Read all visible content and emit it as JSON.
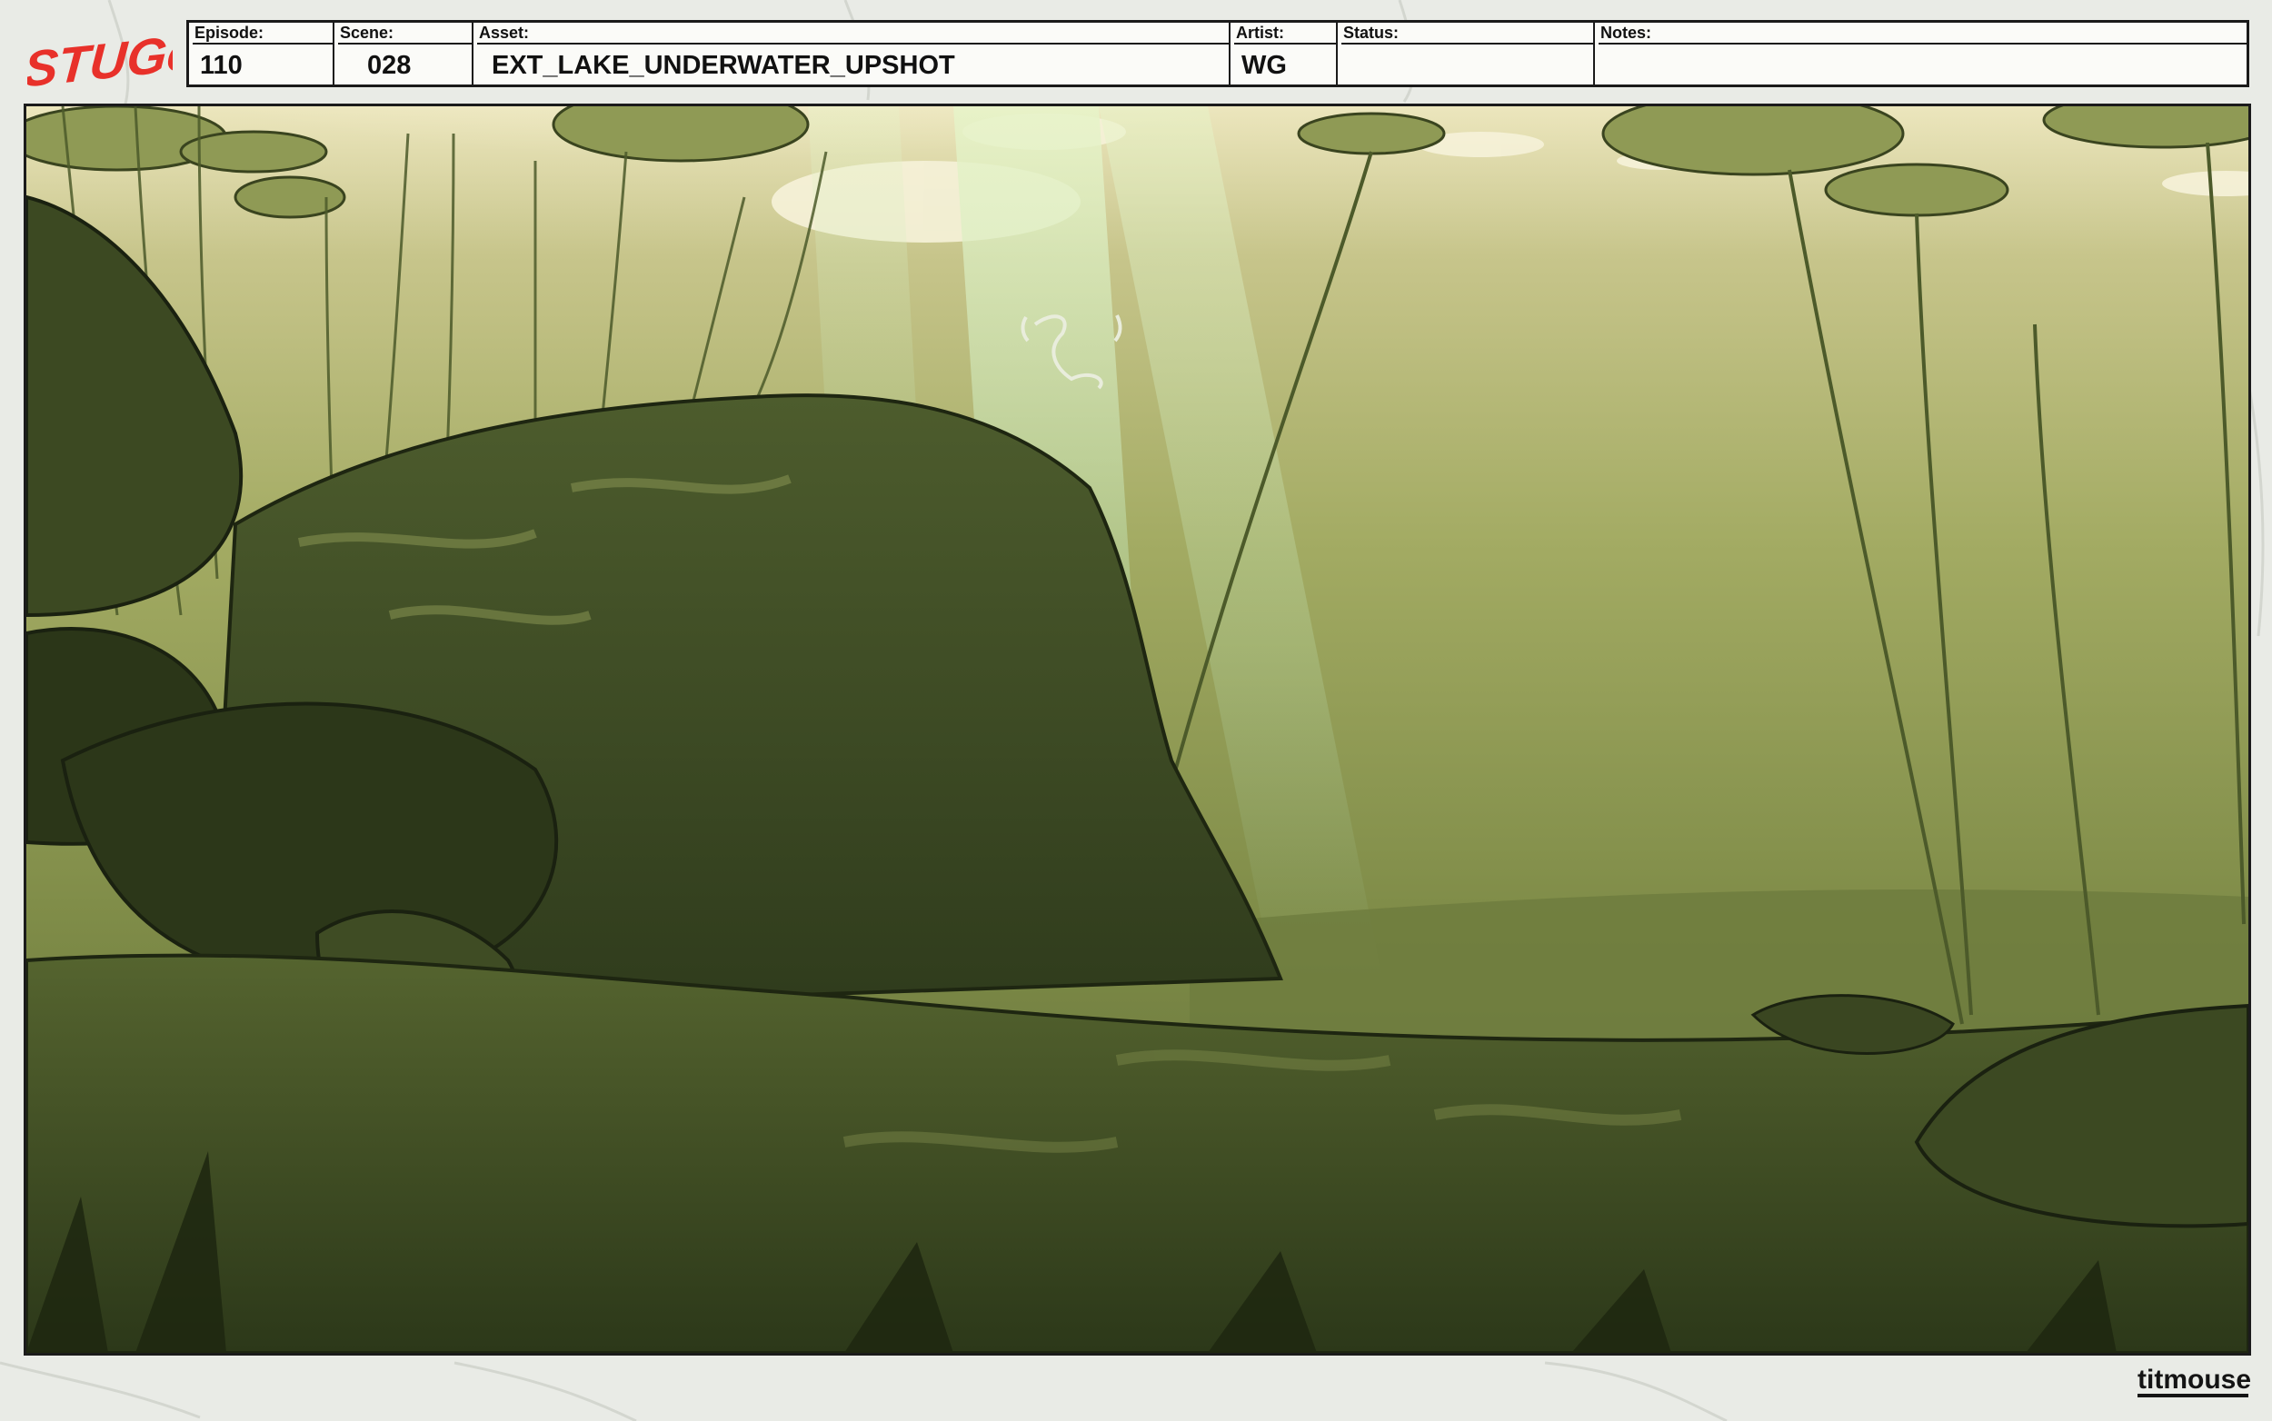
{
  "brand": {
    "show_logo_text": "STUGo",
    "studio_logo_text": "titmouse"
  },
  "slate": {
    "episode": {
      "label": "Episode:",
      "value": "110"
    },
    "scene": {
      "label": "Scene:",
      "value": "028"
    },
    "asset": {
      "label": "Asset:",
      "value": "EXT_LAKE_UNDERWATER_UPSHOT"
    },
    "artist": {
      "label": "Artist:",
      "value": "WG"
    },
    "status": {
      "label": "Status:",
      "value": ""
    },
    "notes": {
      "label": "Notes:",
      "value": ""
    }
  },
  "colors": {
    "water_top": "#e8e2b8",
    "water_mid": "#a6ae66",
    "water_deep": "#5e6e36",
    "rock_dark": "#34401f",
    "rock_shadow": "#222c14",
    "lily_pad": "#8f9a55",
    "light_beam": "#cfe7b8",
    "logo_red": "#e8312a"
  }
}
